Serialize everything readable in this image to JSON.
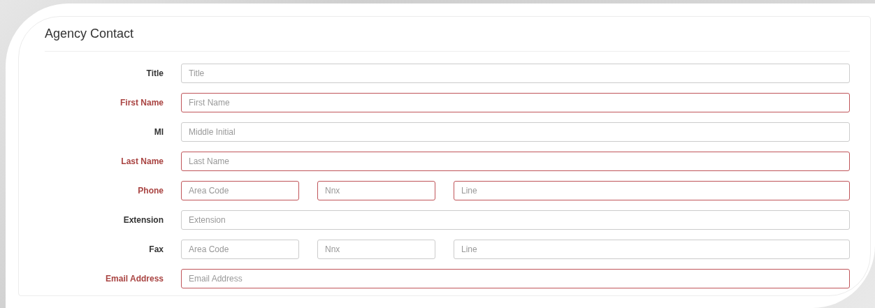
{
  "panel": {
    "title": "Agency Contact"
  },
  "fields": [
    {
      "label": "Title",
      "required": false,
      "inputs": [
        {
          "placeholder": "Title"
        }
      ]
    },
    {
      "label": "First Name",
      "required": true,
      "inputs": [
        {
          "placeholder": "First Name"
        }
      ]
    },
    {
      "label": "MI",
      "required": false,
      "inputs": [
        {
          "placeholder": "Middle Initial"
        }
      ]
    },
    {
      "label": "Last Name",
      "required": true,
      "inputs": [
        {
          "placeholder": "Last Name"
        }
      ]
    },
    {
      "label": "Phone",
      "required": true,
      "inputs": [
        {
          "placeholder": "Area Code"
        },
        {
          "placeholder": "Nnx"
        },
        {
          "placeholder": "Line"
        }
      ]
    },
    {
      "label": "Extension",
      "required": false,
      "inputs": [
        {
          "placeholder": "Extension"
        }
      ]
    },
    {
      "label": "Fax",
      "required": false,
      "inputs": [
        {
          "placeholder": "Area Code"
        },
        {
          "placeholder": "Nnx"
        },
        {
          "placeholder": "Line"
        }
      ]
    },
    {
      "label": "Email Address",
      "required": true,
      "inputs": [
        {
          "placeholder": "Email Address"
        }
      ]
    }
  ]
}
